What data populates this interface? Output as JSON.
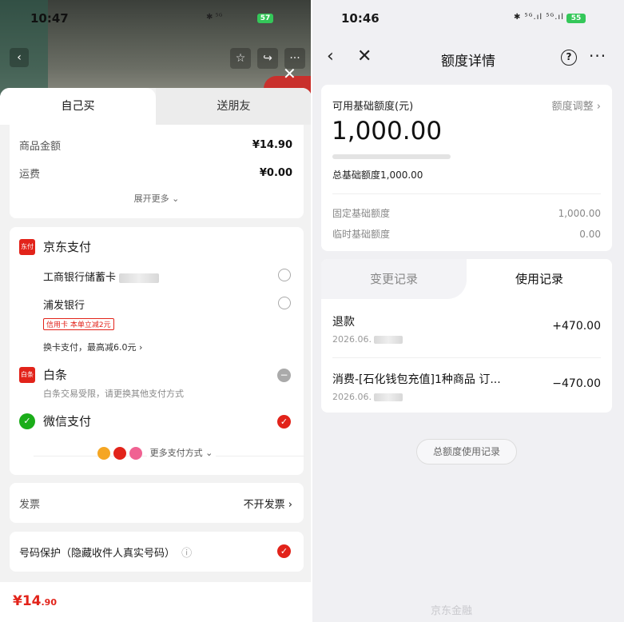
{
  "left": {
    "status_time": "10:47",
    "status_icons": "✱ ⁵ᴳ",
    "battery": "57",
    "tabs": {
      "own": "自己买",
      "gift": "送朋友"
    },
    "amount": {
      "goods_label": "商品金额",
      "goods_value": "¥14.90",
      "shipping_label": "运费",
      "shipping_value": "¥0.00",
      "expand": "展开更多 ⌄"
    },
    "pay": {
      "jd_title": "京东支付",
      "jd_logo": "东付",
      "icbc": "工商银行储蓄卡",
      "spdb": "浦发银行",
      "spdb_tag": "信用卡 本单立减2元",
      "switch_card": "换卡支付，最高减6.0元 ›",
      "baitiao_logo": "白条",
      "baitiao": "白条",
      "baitiao_note": "白条交易受限，请更换其他支付方式",
      "wechat": "微信支付",
      "more": "更多支付方式 ⌄"
    },
    "invoice": {
      "label": "发票",
      "value": "不开发票 ›"
    },
    "protect": {
      "label": "号码保护（隐藏收件人真实号码）",
      "info": "ⓘ"
    },
    "bottom_price": "¥14",
    "bottom_price_dec": ".90"
  },
  "right": {
    "status_time": "10:46",
    "status_icons": "✱ ⁵ᴳ.ıl ⁵ᴳ.ıl",
    "battery": "55",
    "title": "额度详情",
    "quota": {
      "label": "可用基础额度(元)",
      "adjust": "额度调整 ›",
      "amount": "1,000.00",
      "total": "总基础额度1,000.00",
      "fixed_label": "固定基础额度",
      "fixed_value": "1,000.00",
      "temp_label": "临时基础额度",
      "temp_value": "0.00"
    },
    "tabs": {
      "change": "变更记录",
      "use": "使用记录"
    },
    "records": [
      {
        "name": "退款",
        "date": "2026.06.",
        "amount": "+470.00"
      },
      {
        "name": "消费-[石化钱包充值]1种商品 订...",
        "date": "2026.06.",
        "amount": "−470.00"
      }
    ],
    "total_button": "总额度使用记录",
    "watermark": "京东金融"
  },
  "colors": {
    "accent_red": "#e2231a",
    "wechat_green": "#1aad19",
    "battery_green": "#34c759"
  }
}
